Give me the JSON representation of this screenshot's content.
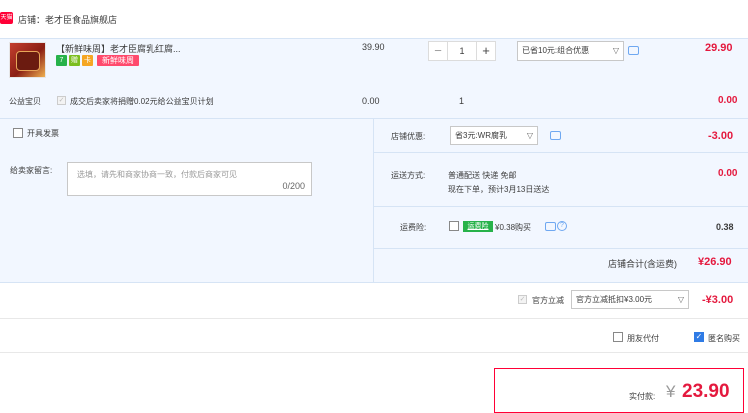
{
  "shop": {
    "badge": "天猫",
    "label": "店铺：老才臣食品旗舰店"
  },
  "item": {
    "title": "【新鲜味周】老才臣腐乳红腐...",
    "tag_icons": [
      "7",
      "赠",
      "卡"
    ],
    "tag_colors": [
      "#27b24a",
      "#7cbe1f",
      "#f5a623"
    ],
    "new_tag": "新鲜味周",
    "price": "39.90",
    "quantity": "1",
    "minus": "−",
    "plus": "+",
    "promo_select": "已省10元:组合优惠",
    "subtotal": "29.90"
  },
  "charity": {
    "label": "公益宝贝",
    "text": "成交后卖家将捐赠0.02元给公益宝贝计划",
    "price": "0.00",
    "qty": "1",
    "amount": "0.00"
  },
  "invoice": {
    "label": "开具发票"
  },
  "memo": {
    "label": "给卖家留言:",
    "placeholder": "选填，请先和商家协商一致，付款后商家可见",
    "count": "0/200"
  },
  "shop_discount": {
    "label": "店铺优惠:",
    "select": "省3元:WR腐乳",
    "amount": "-3.00"
  },
  "shipping": {
    "label": "运送方式:",
    "line1": "普通配送 快递 免邮",
    "line2": "现在下单，预计3月13日送达",
    "amount": "0.00"
  },
  "insurance": {
    "label": "运费险:",
    "tag": "运费险",
    "text": "¥0.38购买",
    "q": "?",
    "amount": "0.38"
  },
  "shop_total": {
    "label": "店铺合计(含运费)",
    "amount": "¥26.90"
  },
  "tmall": {
    "label": "官方立减",
    "select": "官方立减抵扣¥3.00元",
    "amount": "-¥3.00"
  },
  "options": {
    "friend_pay": "朋友代付",
    "anonymous": "匿名购买"
  },
  "final": {
    "label": "实付款:",
    "currency": "¥",
    "amount": "23.90"
  },
  "colors": {
    "accent_red": "#e4193e",
    "panel_blue": "#f2f7ff",
    "border_red": "#ff0036"
  }
}
